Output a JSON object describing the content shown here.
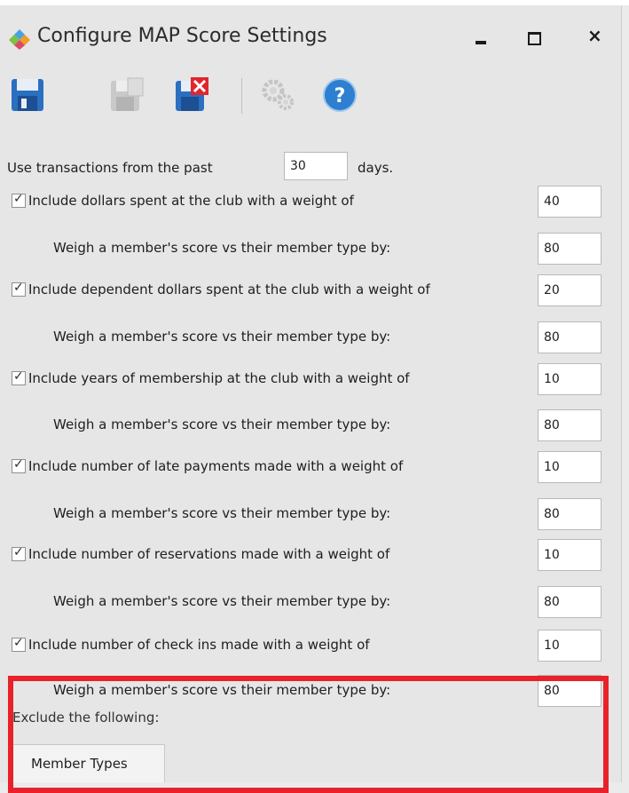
{
  "window": {
    "title": "Configure MAP Score Settings"
  },
  "toolbar": {
    "buttons": [
      {
        "name": "save",
        "icon": "save-icon"
      },
      {
        "name": "save-new",
        "icon": "save-copy-icon"
      },
      {
        "name": "delete",
        "icon": "delete-icon"
      },
      {
        "name": "settings",
        "icon": "gears-icon"
      },
      {
        "name": "help",
        "icon": "help-icon"
      }
    ]
  },
  "days": {
    "prefix": "Use transactions from the past",
    "value": "30",
    "suffix": "days."
  },
  "rows": [
    {
      "checked": true,
      "label": "Include dollars spent at the club with a weight of",
      "value": "40"
    },
    {
      "sub_label": "Weigh a member's score vs their member type by:",
      "value": "80"
    },
    {
      "checked": true,
      "label": "Include dependent dollars spent at the club with a weight of",
      "value": "20"
    },
    {
      "sub_label": "Weigh a member's score vs their member type by:",
      "value": "80"
    },
    {
      "checked": true,
      "label": "Include years of membership at the club with a weight of",
      "value": "10"
    },
    {
      "sub_label": "Weigh a member's score vs their member type by:",
      "value": "80"
    },
    {
      "checked": true,
      "label": "Include number of late payments made with a weight of",
      "value": "10"
    },
    {
      "sub_label": "Weigh a member's score vs their member type by:",
      "value": "80"
    },
    {
      "checked": true,
      "label": "Include number of reservations made with a weight of",
      "value": "10"
    },
    {
      "sub_label": "Weigh a member's score vs their member type by:",
      "value": "80"
    },
    {
      "checked": true,
      "label": "Include number of check ins made with a weight of",
      "value": "10"
    },
    {
      "sub_label": "Weigh a member's score vs their member type by:",
      "value": "80"
    }
  ],
  "exclude": {
    "label": "Exclude the following:"
  },
  "tabs": [
    "Member Types"
  ],
  "colors": {
    "highlight": "#e8212a",
    "window_bg": "#e6e6e6"
  }
}
